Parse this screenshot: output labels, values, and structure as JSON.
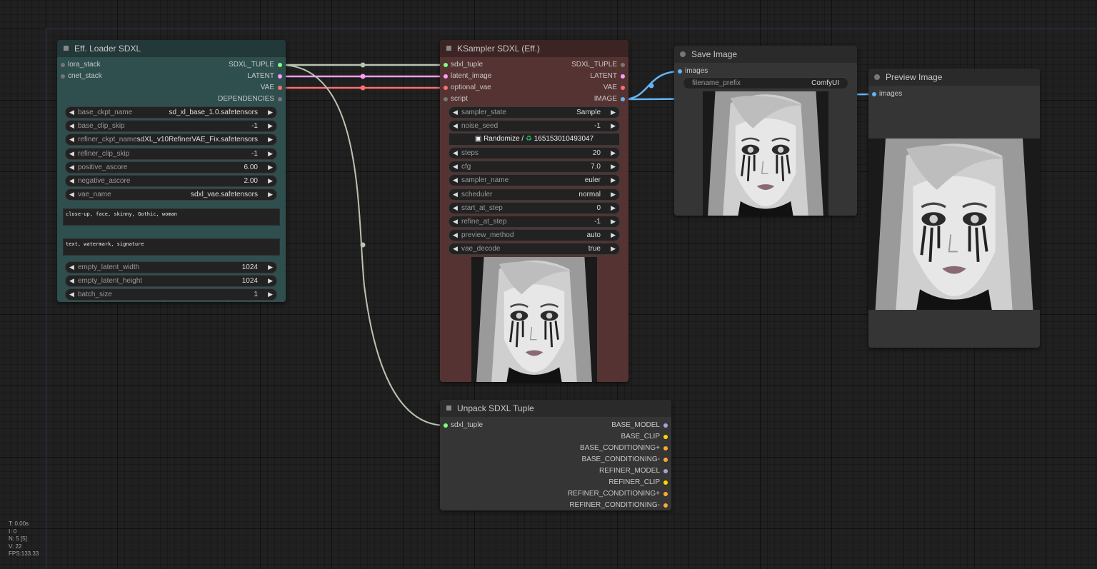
{
  "loader": {
    "title": "Eff. Loader SDXL",
    "inputs": [
      "lora_stack",
      "cnet_stack"
    ],
    "outputs": [
      "SDXL_TUPLE",
      "LATENT",
      "VAE",
      "DEPENDENCIES"
    ],
    "widgets": [
      {
        "label": "base_ckpt_name",
        "value": "sd_xl_base_1.0.safetensors"
      },
      {
        "label": "base_clip_skip",
        "value": "-1"
      },
      {
        "label": "refiner_ckpt_name",
        "value": "sdXL_v10RefinerVAE_Fix.safetensors"
      },
      {
        "label": "refiner_clip_skip",
        "value": "-1"
      },
      {
        "label": "positive_ascore",
        "value": "6.00"
      },
      {
        "label": "negative_ascore",
        "value": "2.00"
      },
      {
        "label": "vae_name",
        "value": "sdxl_vae.safetensors"
      }
    ],
    "positive_prompt": "close-up, face, skinny, Gothic, woman",
    "negative_prompt": "text, watermark, signature",
    "widgets2": [
      {
        "label": "empty_latent_width",
        "value": "1024"
      },
      {
        "label": "empty_latent_height",
        "value": "1024"
      },
      {
        "label": "batch_size",
        "value": "1"
      }
    ]
  },
  "ksampler": {
    "title": "KSampler SDXL (Eff.)",
    "inputs": [
      "sdxl_tuple",
      "latent_image",
      "optional_vae",
      "script"
    ],
    "outputs": [
      "SDXL_TUPLE",
      "LATENT",
      "VAE",
      "IMAGE"
    ],
    "widgets_a": [
      {
        "label": "sampler_state",
        "value": "Sample"
      },
      {
        "label": "noise_seed",
        "value": "-1"
      }
    ],
    "seed_button": {
      "randomize": "Randomize /",
      "seed": "165153010493047"
    },
    "widgets_b": [
      {
        "label": "steps",
        "value": "20"
      },
      {
        "label": "cfg",
        "value": "7.0"
      },
      {
        "label": "sampler_name",
        "value": "euler"
      },
      {
        "label": "scheduler",
        "value": "normal"
      },
      {
        "label": "start_at_step",
        "value": "0"
      },
      {
        "label": "refine_at_step",
        "value": "-1"
      },
      {
        "label": "preview_method",
        "value": "auto"
      },
      {
        "label": "vae_decode",
        "value": "true"
      }
    ]
  },
  "save": {
    "title": "Save Image",
    "input": "images",
    "widget": {
      "label": "filename_prefix",
      "value": "ComfyUI"
    }
  },
  "preview": {
    "title": "Preview Image",
    "input": "images"
  },
  "unpack": {
    "title": "Unpack SDXL Tuple",
    "input": "sdxl_tuple",
    "outputs": [
      "BASE_MODEL",
      "BASE_CLIP",
      "BASE_CONDITIONING+",
      "BASE_CONDITIONING-",
      "REFINER_MODEL",
      "REFINER_CLIP",
      "REFINER_CONDITIONING+",
      "REFINER_CONDITIONING-"
    ]
  },
  "stats": [
    "T: 0.00s",
    "I: 0",
    "N: 5 [5]",
    "V: 22",
    "FPS:133.33"
  ],
  "colors": {
    "tuple_link": "#b8c4b0",
    "latent_link": "#ff9cf9",
    "vae_link": "#ff6e6e",
    "image_link": "#64b5f6",
    "model_slot": "#b39ddb",
    "clip_slot": "#ffd500",
    "cond_slot": "#ffa931"
  },
  "icons": [
    "collapse-box-icon",
    "dice-icon",
    "recycle-icon",
    "arrow-left-icon",
    "arrow-right-icon"
  ]
}
